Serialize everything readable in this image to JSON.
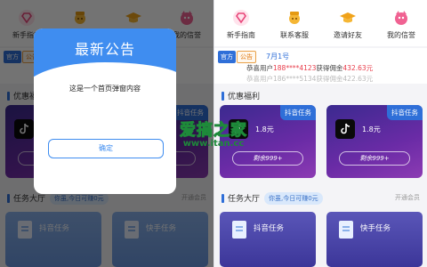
{
  "nav": {
    "items": [
      {
        "label": "新手指南",
        "icon": "heart-diamond-icon"
      },
      {
        "label": "联系客服",
        "icon": "hat-avatar-icon"
      },
      {
        "label": "邀请好友",
        "icon": "graduation-cap-icon"
      },
      {
        "label": "我的信誉",
        "icon": "pink-mascot-icon"
      }
    ]
  },
  "notice": {
    "official": "官方",
    "badge": "公告",
    "date": "7月1号",
    "line1_prefix": "恭喜用户",
    "line1_phone": "188****4123",
    "line1_mid": "获得佣金",
    "line1_amount": "432.63元",
    "line2": "恭喜用户186****5134获得佣金422.63元"
  },
  "welfare": {
    "title": "优惠福利",
    "cards": [
      {
        "tag": "抖音任务",
        "price": "1.8元",
        "remain": "剩余999+"
      },
      {
        "tag": "抖音任务",
        "price": "1.8元",
        "remain": "剩余999+"
      }
    ]
  },
  "task_hall": {
    "title": "任务大厅",
    "earn_pill": "你虽,今日可赚0元",
    "open_member": "开通会员",
    "tiles": [
      {
        "label": "抖音任务"
      },
      {
        "label": "快手任务"
      }
    ]
  },
  "modal": {
    "title": "最新公告",
    "body": "这是一个首页弹窗内容",
    "confirm": "确定"
  },
  "watermark": {
    "cn": "爱搞之家",
    "url": "www.itan.cc"
  },
  "colors": {
    "accent": "#3f8df0",
    "brand_blue": "#2f6fd8",
    "highlight": "#e83c4a",
    "card_purple": "#6a2ba6"
  }
}
